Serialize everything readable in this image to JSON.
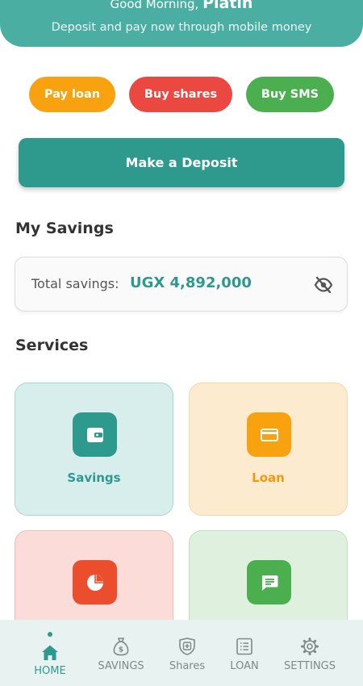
{
  "header": {
    "greeting": "Good Morning,",
    "user_name": "Platin",
    "subtitle": "Deposit and pay now through mobile money",
    "color": "#4aaea3"
  },
  "quick_actions": [
    {
      "label": "Pay loan",
      "color": "#f7a20e"
    },
    {
      "label": "Buy shares",
      "color": "#ea4841"
    },
    {
      "label": "Buy SMS",
      "color": "#4bae4f"
    }
  ],
  "deposit_button": {
    "label": "Make a Deposit",
    "color": "#2e9a8e"
  },
  "savings": {
    "section_title": "My Savings",
    "label": "Total savings:",
    "value": "UGX 4,892,000",
    "toggle_icon": "eye-off-icon"
  },
  "services": {
    "section_title": "Services",
    "tiles": [
      {
        "label": "Savings",
        "icon": "wallet-icon",
        "color": "#2e9a8e"
      },
      {
        "label": "Loan",
        "icon": "credit-card-icon",
        "color": "#f7a20e"
      },
      {
        "label": "",
        "icon": "pie-chart-icon",
        "color": "#ea4e2c"
      },
      {
        "label": "",
        "icon": "message-icon",
        "color": "#4bae4f"
      }
    ]
  },
  "bottom_nav": {
    "active": "HOME",
    "items": [
      {
        "label": "HOME",
        "icon": "home-icon"
      },
      {
        "label": "SAVINGS",
        "icon": "money-bag-icon"
      },
      {
        "label": "Shares",
        "icon": "shield-plus-icon"
      },
      {
        "label": "LOAN",
        "icon": "list-icon"
      },
      {
        "label": "SETTINGS",
        "icon": "gear-icon"
      }
    ]
  }
}
